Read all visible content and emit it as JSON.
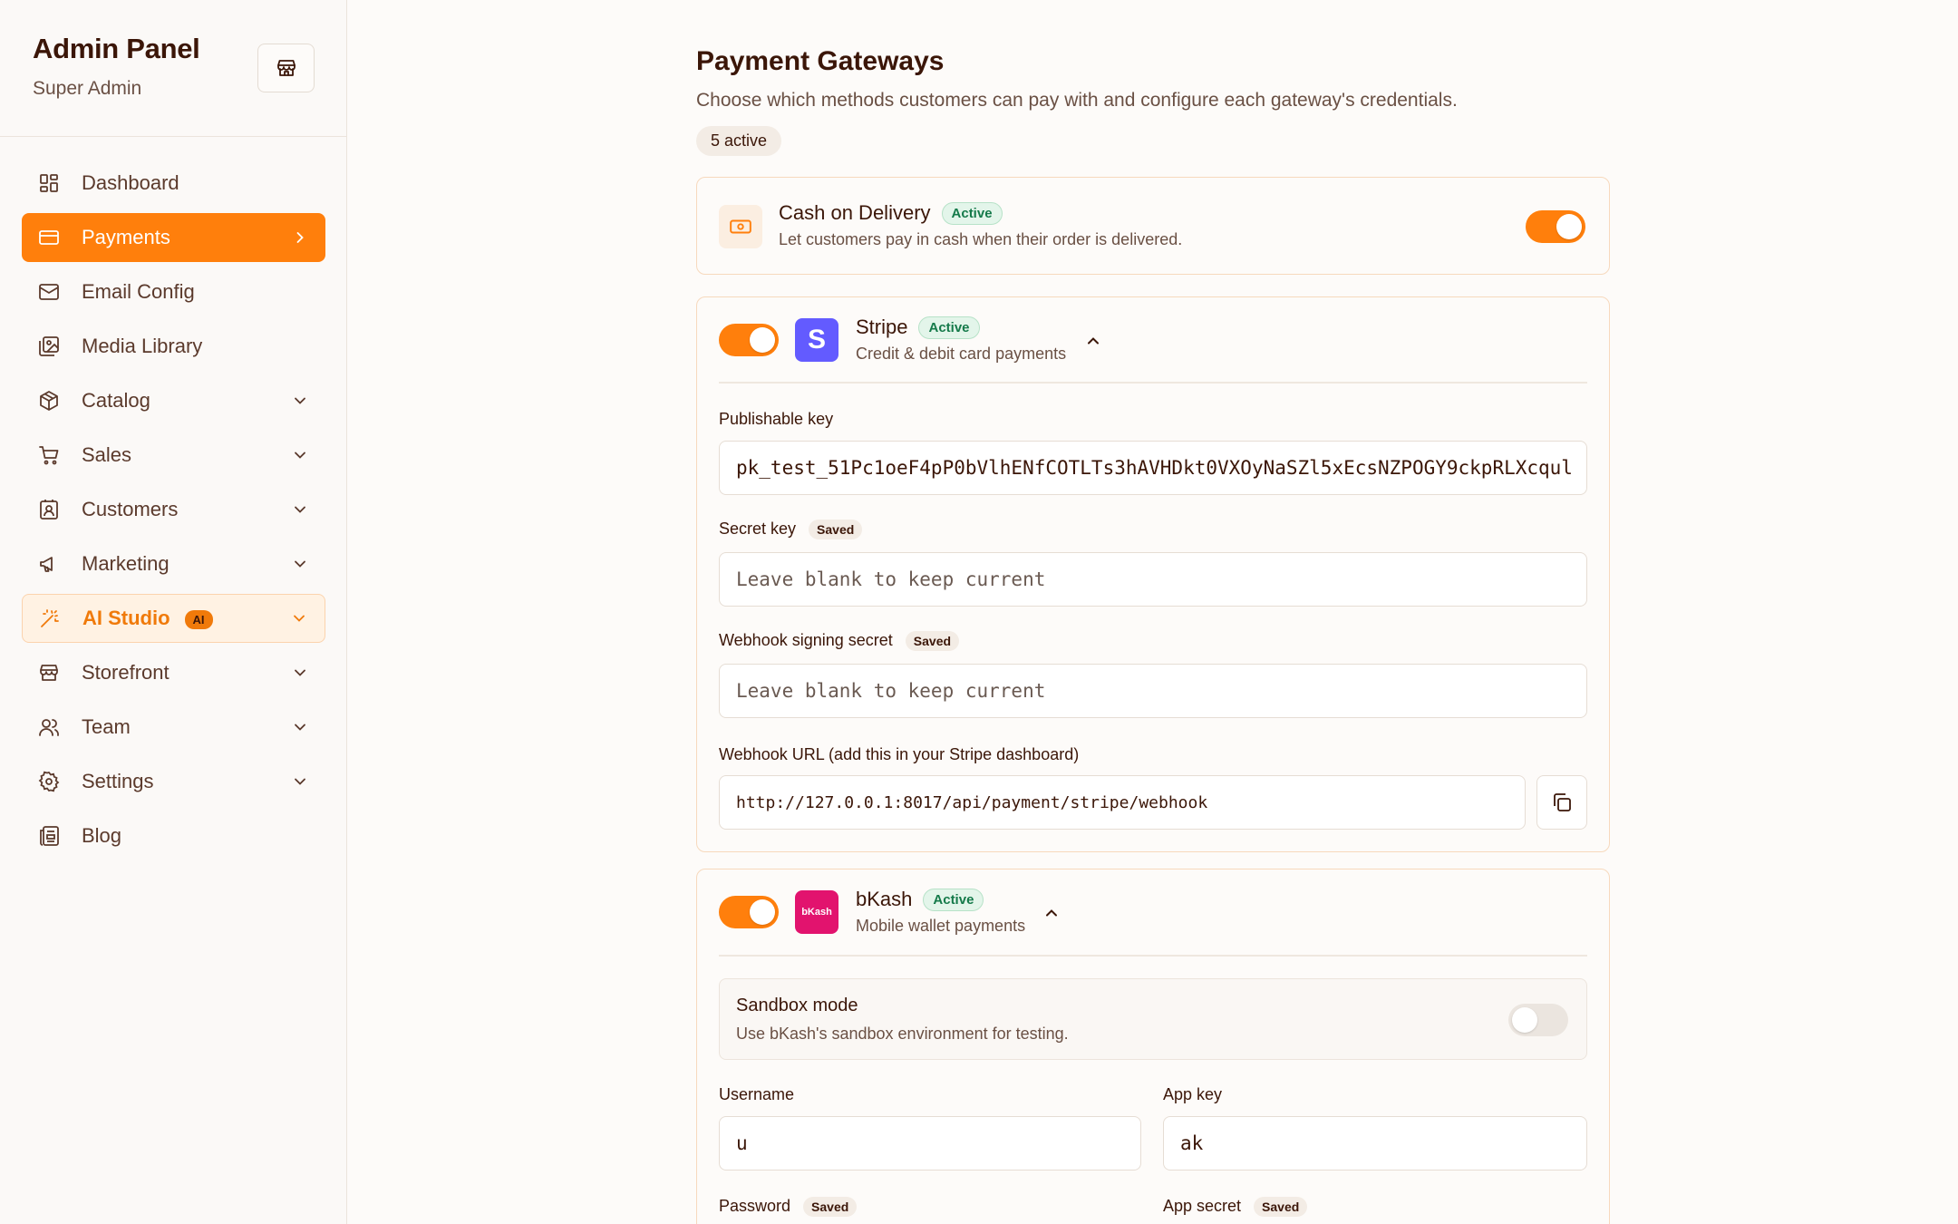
{
  "sidebar": {
    "title": "Admin Panel",
    "subtitle": "Super Admin",
    "nav": [
      {
        "label": "Dashboard",
        "icon": "dashboard-icon",
        "expandable": false
      },
      {
        "label": "Payments",
        "icon": "credit-card-icon",
        "active": true
      },
      {
        "label": "Email Config",
        "icon": "mail-icon",
        "expandable": false
      },
      {
        "label": "Media Library",
        "icon": "image-icon",
        "expandable": false
      },
      {
        "label": "Catalog",
        "icon": "box-icon",
        "expandable": true
      },
      {
        "label": "Sales",
        "icon": "cart-icon",
        "expandable": true
      },
      {
        "label": "Customers",
        "icon": "contact-icon",
        "expandable": true
      },
      {
        "label": "Marketing",
        "icon": "megaphone-icon",
        "expandable": true
      },
      {
        "label": "AI Studio",
        "icon": "magic-wand-icon",
        "badge": "AI",
        "expandable": true
      },
      {
        "label": "Storefront",
        "icon": "store-icon",
        "expandable": true
      },
      {
        "label": "Team",
        "icon": "users-icon",
        "expandable": true
      },
      {
        "label": "Settings",
        "icon": "gear-icon",
        "expandable": true
      },
      {
        "label": "Blog",
        "icon": "newspaper-icon",
        "expandable": false
      }
    ]
  },
  "page": {
    "title": "Payment Gateways",
    "description": "Choose which methods customers can pay with and configure each gateway's credentials.",
    "active_count": "5 active"
  },
  "cod": {
    "name": "Cash on Delivery",
    "status": "Active",
    "description": "Let customers pay in cash when their order is delivered.",
    "enabled": true
  },
  "stripe": {
    "name": "Stripe",
    "logo_letter": "S",
    "status": "Active",
    "description": "Credit & debit card payments",
    "enabled": true,
    "publishable_key_label": "Publishable key",
    "publishable_key_value": "pk_test_51Pc1oeF4pP0bVlhENfCOTLTs3hAVHDkt0VXOyNaSZl5xEcsNZPOGY9ckpRLXcqul",
    "secret_key_label": "Secret key",
    "secret_key_saved": "Saved",
    "secret_key_placeholder": "Leave blank to keep current",
    "webhook_secret_label": "Webhook signing secret",
    "webhook_secret_saved": "Saved",
    "webhook_secret_placeholder": "Leave blank to keep current",
    "webhook_url_label": "Webhook URL (add this in your Stripe dashboard)",
    "webhook_url_value": "http://127.0.0.1:8017/api/payment/stripe/webhook"
  },
  "bkash": {
    "name": "bKash",
    "logo_text": "bKash",
    "status": "Active",
    "description": "Mobile wallet payments",
    "enabled": true,
    "sandbox_title": "Sandbox mode",
    "sandbox_description": "Use bKash's sandbox environment for testing.",
    "sandbox_enabled": false,
    "username_label": "Username",
    "username_value": "u",
    "app_key_label": "App key",
    "app_key_value": "ak",
    "password_label": "Password",
    "password_saved": "Saved",
    "app_secret_label": "App secret",
    "app_secret_saved": "Saved"
  },
  "colors": {
    "accent": "#ff7f0c",
    "stripe": "#635bff",
    "bkash": "#e2136e",
    "active_badge": "#157a4a"
  }
}
